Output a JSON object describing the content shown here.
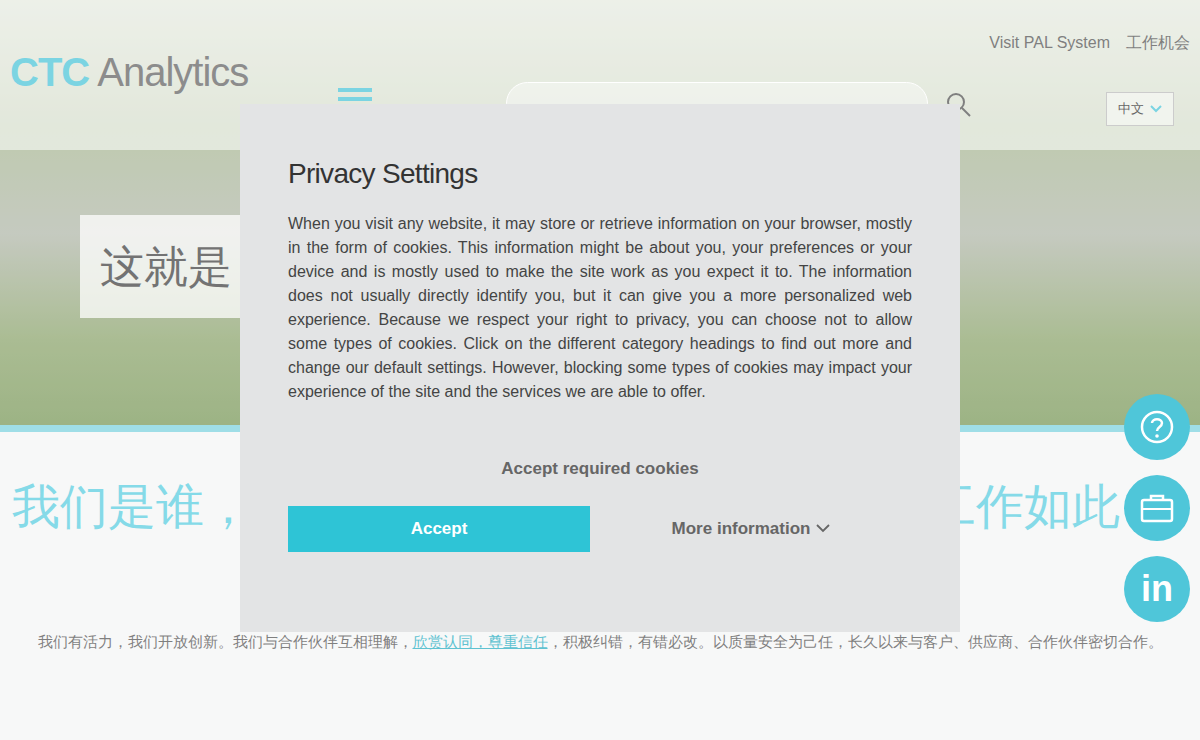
{
  "header": {
    "logo": {
      "mark": "CTC",
      "name": "Analytics"
    },
    "links": [
      "Visit PAL System",
      "工作机会"
    ],
    "language": "中文"
  },
  "hero": {
    "title": "这就是"
  },
  "intro": {
    "heading_left": "我们是谁，",
    "heading_right": "工作如此",
    "text_before": "我们有活力，我们开放创新。我们与合作伙伴互相理解，",
    "link": "欣赏认同，尊重信任",
    "text_after": "，积极纠错，有错必改。以质量安全为己任，长久以来与客户、供应商、合作伙伴密切合作。"
  },
  "side_buttons": {
    "linkedin": "in"
  },
  "modal": {
    "title": "Privacy Settings",
    "body": "When you visit any website, it may store or retrieve information on your browser, mostly in the form of cookies. This information might be about you, your preferences or your device and is mostly used to make the site work as you expect it to. The information does not usually directly identify you, but it can give you a more personalized web experience. Because we respect your right to privacy, you can choose not to allow some types of cookies. Click on the different category headings to find out more and change our default settings. However, blocking some types of cookies may impact your experience of the site and the services we are able to offer.",
    "accept_required": "Accept required cookies",
    "accept": "Accept",
    "more_info": "More information"
  }
}
